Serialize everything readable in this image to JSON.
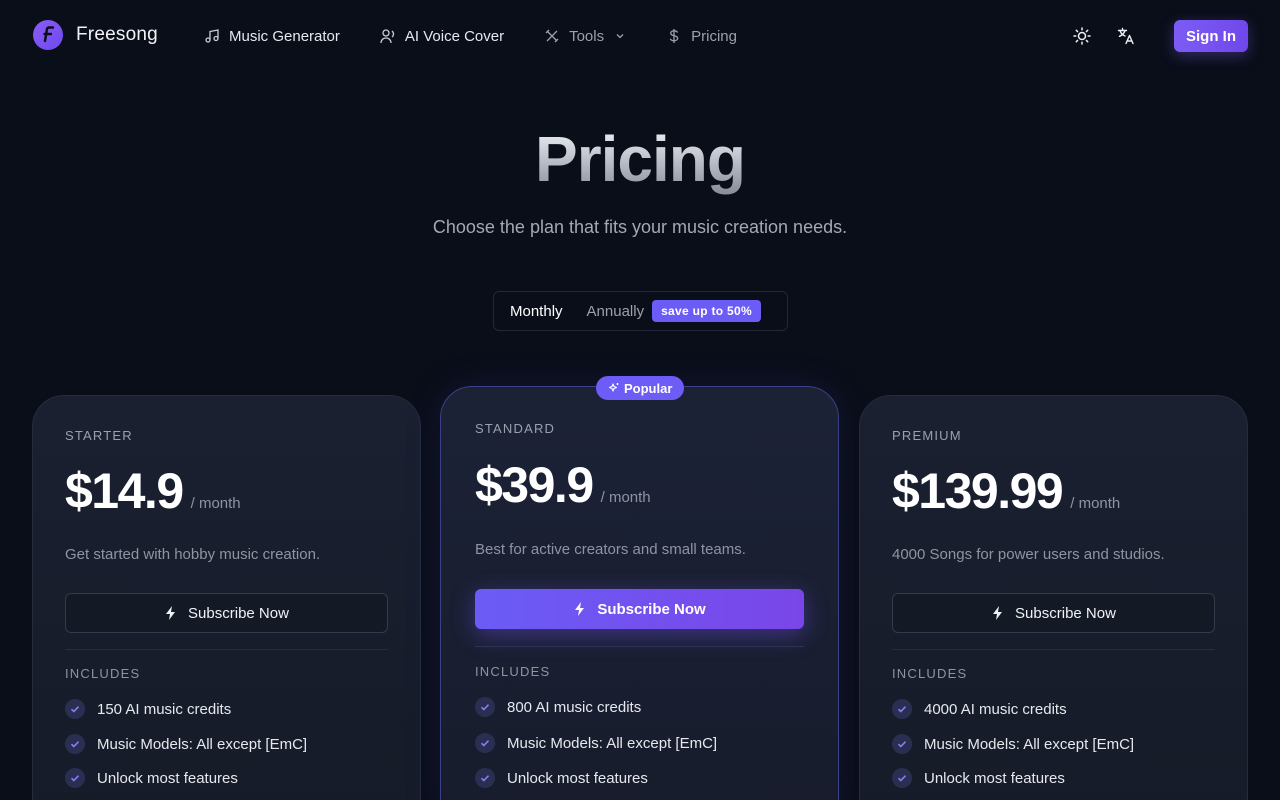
{
  "nav": {
    "brand": "Freesong",
    "items": [
      {
        "label": "Music Generator",
        "icon": "music-note-icon"
      },
      {
        "label": "AI Voice Cover",
        "icon": "voice-user-icon"
      },
      {
        "label": "Tools",
        "icon": "tools-icon"
      },
      {
        "label": "Pricing",
        "icon": "dollar-icon"
      }
    ],
    "signin": "Sign In"
  },
  "hero": {
    "title": "Pricing",
    "subtitle": "Choose the plan that fits your music creation needs."
  },
  "billing": {
    "monthly": "Monthly",
    "annually": "Annually",
    "save_badge": "save up to 50%",
    "selected": "Monthly"
  },
  "popular_badge": "Popular",
  "plans": [
    {
      "name": "STARTER",
      "price": "$14.9",
      "per": "/ month",
      "description": "Get started with hobby music creation.",
      "button": "Subscribe Now",
      "includes_label": "INCLUDES",
      "features": [
        "150 AI music credits",
        "Music Models: All except [EmC]",
        "Unlock most features"
      ]
    },
    {
      "name": "STANDARD",
      "price": "$39.9",
      "per": "/ month",
      "description": "Best for active creators and small teams.",
      "button": "Subscribe Now",
      "includes_label": "INCLUDES",
      "features": [
        "800 AI music credits",
        "Music Models: All except [EmC]",
        "Unlock most features"
      ]
    },
    {
      "name": "PREMIUM",
      "price": "$139.99",
      "per": "/ month",
      "description": "4000 Songs for power users and studios.",
      "button": "Subscribe Now",
      "includes_label": "INCLUDES",
      "features": [
        "4000 AI music credits",
        "Music Models: All except [EmC]",
        "Unlock most features"
      ]
    }
  ],
  "colors": {
    "accent": "#6d5cf6",
    "background": "#0a0e19",
    "card": "#1a2030"
  }
}
